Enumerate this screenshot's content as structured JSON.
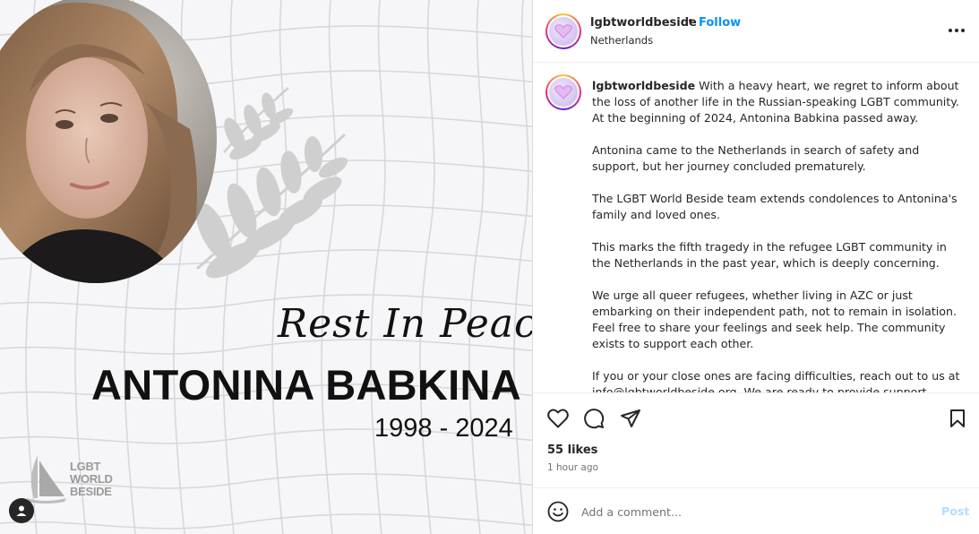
{
  "image": {
    "script_title": "Rest In Peace",
    "name": "ANTONINA BABKINA",
    "years": "1998 - 2024",
    "brand_lines": [
      "LGBT",
      "WORLD",
      "BESIDE"
    ]
  },
  "header": {
    "username": "lgbtworldbeside",
    "separator": "•",
    "follow_label": "Follow",
    "location": "Netherlands"
  },
  "caption": {
    "username": "lgbtworldbeside",
    "paragraphs": [
      "With a heavy heart, we regret to inform about the loss of another life in the Russian-speaking LGBT community. At the beginning of 2024, Antonina Babkina passed away.",
      "Antonina came to the Netherlands in search of safety and support, but her journey concluded prematurely.",
      "The LGBT World Beside team extends condolences to Antonina's family and loved ones.",
      "This marks the fifth tragedy in the refugee LGBT community in the Netherlands in the past year, which is deeply concerning.",
      "We urge all queer refugees, whether living in AZC or just embarking on their independent path, not to remain in isolation. Feel free to share your feelings and seek help. The community exists to support each other.",
      "If you or your close ones are facing difficulties, reach out to us at info@lgbtworldbeside.org. We are ready to provide support."
    ]
  },
  "engagement": {
    "likes": "55 likes",
    "time": "1 hour ago"
  },
  "comment": {
    "placeholder": "Add a comment...",
    "post_label": "Post"
  },
  "icons": {
    "like": "heart-icon",
    "comment": "comment-icon",
    "share": "share-icon",
    "save": "bookmark-icon",
    "emoji": "emoji-icon",
    "more": "more-options-icon",
    "user_tag": "user-tag-icon"
  },
  "colors": {
    "accent": "#0095f6",
    "post_disabled": "#b3dbff",
    "text": "#262626",
    "muted": "#737373"
  }
}
